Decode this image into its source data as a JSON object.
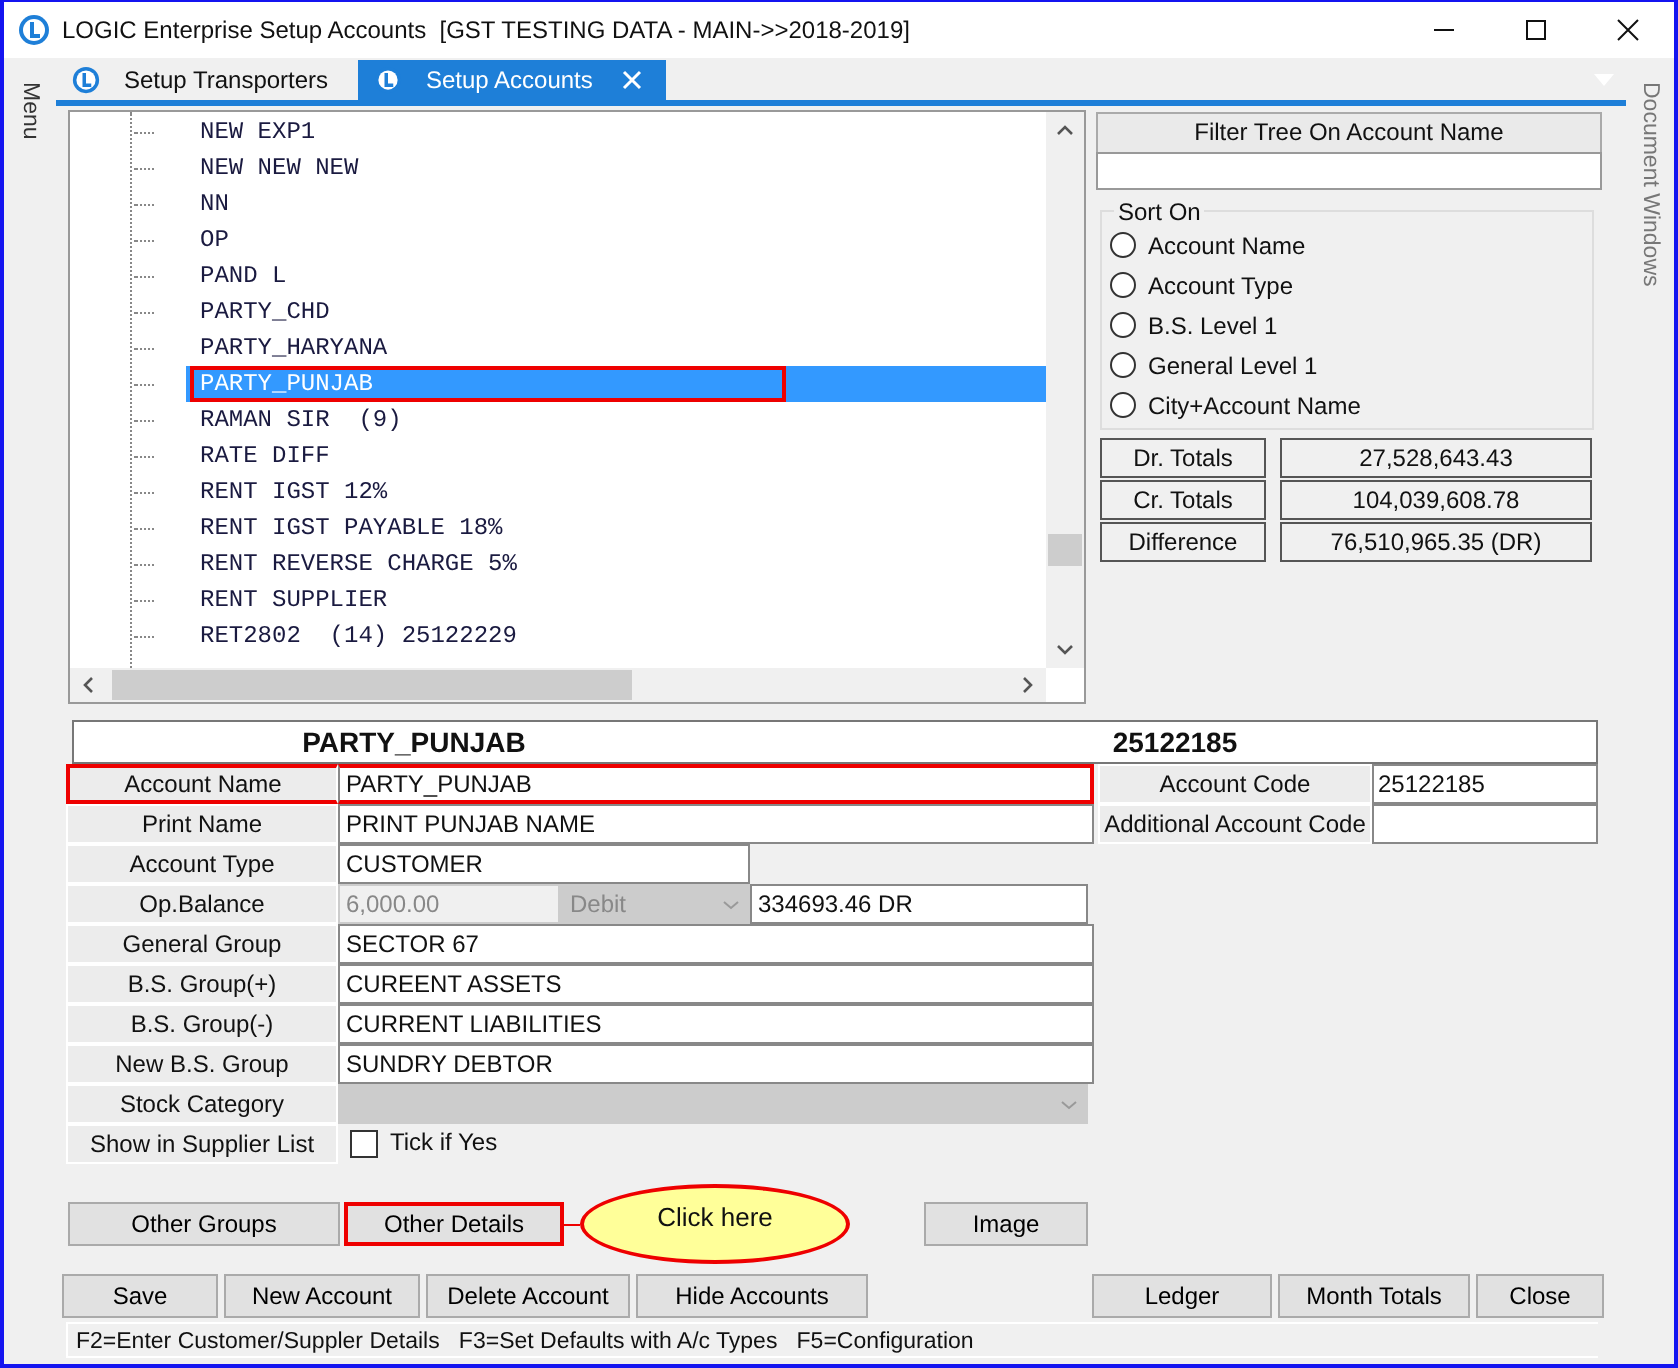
{
  "window": {
    "title": "LOGIC Enterprise Setup Accounts  [GST TESTING DATA - MAIN->>2018-2019]"
  },
  "side_menu": {
    "label": "Menu"
  },
  "document_windows": {
    "label": "Document Windows"
  },
  "tabs": [
    {
      "label": "Setup Transporters",
      "selected": false,
      "closable": false
    },
    {
      "label": "Setup Accounts",
      "selected": true,
      "closable": true
    }
  ],
  "tree": {
    "items": [
      {
        "label": "NEW EXP1",
        "selected": false,
        "marked": false
      },
      {
        "label": "NEW NEW NEW",
        "selected": false,
        "marked": false
      },
      {
        "label": "NN",
        "selected": false,
        "marked": false
      },
      {
        "label": "OP",
        "selected": false,
        "marked": false
      },
      {
        "label": "PAND L",
        "selected": false,
        "marked": false
      },
      {
        "label": "PARTY_CHD",
        "selected": false,
        "marked": false
      },
      {
        "label": "PARTY_HARYANA",
        "selected": false,
        "marked": false
      },
      {
        "label": "PARTY_PUNJAB",
        "selected": true,
        "marked": true
      },
      {
        "label": "RAMAN SIR  (9)",
        "selected": false,
        "marked": false
      },
      {
        "label": "RATE DIFF",
        "selected": false,
        "marked": false
      },
      {
        "label": "RENT IGST 12%",
        "selected": false,
        "marked": false
      },
      {
        "label": "RENT IGST PAYABLE 18%",
        "selected": false,
        "marked": false
      },
      {
        "label": "RENT REVERSE CHARGE 5%",
        "selected": false,
        "marked": false
      },
      {
        "label": "RENT SUPPLIER",
        "selected": false,
        "marked": false
      },
      {
        "label": "RET2802  (14) 25122229",
        "selected": false,
        "marked": false
      }
    ]
  },
  "filter": {
    "label": "Filter Tree On Account Name"
  },
  "sort": {
    "title": "Sort On",
    "options": [
      {
        "label": "Account Name",
        "selected": false
      },
      {
        "label": "Account Type",
        "selected": false
      },
      {
        "label": "B.S. Level 1",
        "selected": false
      },
      {
        "label": "General Level 1",
        "selected": false
      },
      {
        "label": "City+Account Name",
        "selected": false
      }
    ]
  },
  "totals": [
    {
      "label": "Dr. Totals",
      "value": "27,528,643.43"
    },
    {
      "label": "Cr. Totals",
      "value": "104,039,608.78"
    },
    {
      "label": "Difference",
      "value": "76,510,965.35 (DR)"
    }
  ],
  "header": {
    "name": "PARTY_PUNJAB",
    "code": "25122185"
  },
  "fields": [
    {
      "kind": "text",
      "label": "Account Name",
      "value": "PARTY_PUNJAB",
      "marked": true,
      "side": {
        "label": "Account Code",
        "value": "25122185"
      }
    },
    {
      "kind": "text",
      "label": "Print Name",
      "value": "PRINT PUNJAB NAME",
      "marked": false,
      "side": {
        "label": "Additional Account Code"
      }
    },
    {
      "kind": "short",
      "label": "Account Type",
      "value": "CUSTOMER",
      "marked": false
    },
    {
      "kind": "balance",
      "label": "Op.Balance",
      "value": "6,000.00",
      "disabled": true,
      "mode": "Debit",
      "closing": "334693.46 DR",
      "marked": false
    },
    {
      "kind": "text",
      "label": "General Group",
      "value": "SECTOR 67",
      "marked": false
    },
    {
      "kind": "text",
      "label": "B.S. Group(+)",
      "value": "CUREENT ASSETS",
      "marked": false
    },
    {
      "kind": "text",
      "label": "B.S. Group(-)",
      "value": "CURRENT LIABILITIES",
      "marked": false
    },
    {
      "kind": "text",
      "label": "New B.S. Group",
      "value": "SUNDRY DEBTOR",
      "marked": false
    },
    {
      "kind": "select",
      "label": "Stock Category",
      "disabled": true,
      "marked": false
    },
    {
      "kind": "checkbox",
      "label": "Show in Supplier List",
      "option": "Tick if Yes",
      "checked": false,
      "marked": false
    }
  ],
  "action_buttons": [
    {
      "label": "Other Groups",
      "marked": false
    },
    {
      "label": "Other Details",
      "marked": true,
      "callout": "Click here"
    },
    {
      "label": "Image",
      "marked": false
    }
  ],
  "bottom_buttons_left": [
    "Save",
    "New Account",
    "Delete Account",
    "Hide Accounts"
  ],
  "bottom_buttons_right": [
    "Ledger",
    "Month Totals",
    "Close"
  ],
  "status_bar": "F2=Enter Customer/Suppler Details   F3=Set Defaults with A/c Types   F5=Configuration"
}
